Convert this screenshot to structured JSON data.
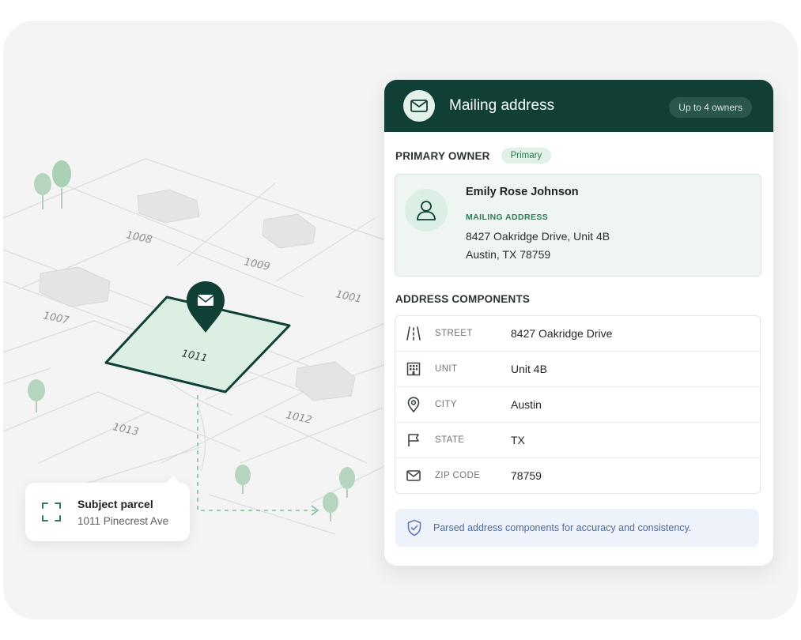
{
  "map": {
    "lots": [
      "1008",
      "1009",
      "1007",
      "1001",
      "1011",
      "1013",
      "1012"
    ],
    "subject_callout": {
      "title": "Subject parcel",
      "address": "1011 Pinecrest Ave"
    }
  },
  "card": {
    "title": "Mailing address",
    "owners_badge": "Up to 4 owners",
    "primary_section_title": "PRIMARY OWNER",
    "primary_badge": "Primary",
    "owner": {
      "name": "Emily Rose Johnson",
      "label": "MAILING ADDRESS",
      "line1": "8427 Oakridge Drive, Unit 4B",
      "line2": "Austin, TX 78759"
    },
    "components_title": "ADDRESS COMPONENTS",
    "components": [
      {
        "icon": "road-icon",
        "key": "STREET",
        "value": "8427 Oakridge Drive"
      },
      {
        "icon": "building-icon",
        "key": "UNIT",
        "value": "Unit 4B"
      },
      {
        "icon": "location-pin-icon",
        "key": "CITY",
        "value": "Austin"
      },
      {
        "icon": "flag-icon",
        "key": "STATE",
        "value": "TX"
      },
      {
        "icon": "envelope-icon",
        "key": "ZIP CODE",
        "value": "78759"
      }
    ],
    "note": "Parsed address components for accuracy and consistency."
  },
  "colors": {
    "header_bg": "#0f3f35",
    "accent_green": "#2e7d55",
    "parcel_fill": "#dcefe3",
    "note_text": "#4d6aa0"
  }
}
